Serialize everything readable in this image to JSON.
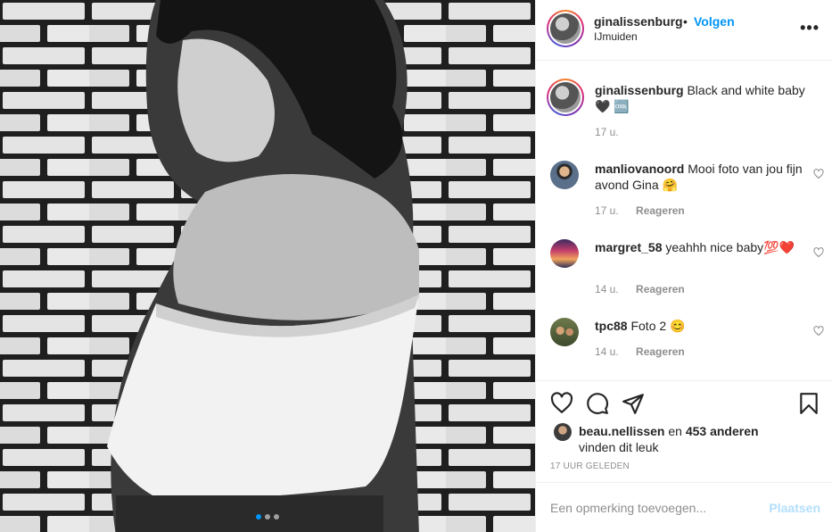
{
  "post": {
    "username": "ginalissenburg",
    "separator": "•",
    "follow_label": "Volgen",
    "location": "IJmuiden",
    "more_label": "•••"
  },
  "caption": {
    "username": "ginalissenburg",
    "text": "Black and white baby",
    "emoji": "🖤 🆒",
    "time": "17 u."
  },
  "comments": [
    {
      "username": "manliovanoord",
      "text": "Mooi foto van jou fijn avond Gina 🤗",
      "time": "17 u.",
      "reply_label": "Reageren"
    },
    {
      "username": "margret_58",
      "text": "yeahhh nice baby💯❤️",
      "time": "14 u.",
      "reply_label": "Reageren"
    },
    {
      "username": "tpc88",
      "text": "Foto 2 😊",
      "time": "14 u.",
      "reply_label": "Reageren"
    }
  ],
  "likes": {
    "first_user": "beau.nellissen",
    "connector": " en ",
    "others": "453 anderen",
    "suffix": "vinden dit leuk"
  },
  "timestamp": "17 UUR GELEDEN",
  "add_comment": {
    "placeholder": "Een opmerking toevoegen...",
    "post_label": "Plaatsen"
  },
  "carousel": {
    "count": 3,
    "active_index": 0
  },
  "colors": {
    "accent": "#0095f6",
    "disabled_accent": "#b3dffc",
    "text": "#262626",
    "muted": "#8e8e8e"
  },
  "icons": [
    "heart-icon",
    "comment-icon",
    "share-icon",
    "bookmark-icon",
    "more-icon"
  ]
}
